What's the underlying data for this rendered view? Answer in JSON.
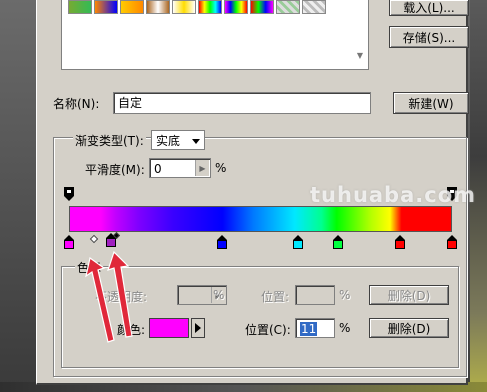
{
  "buttons": {
    "load": "载入(L)...",
    "save": "存储(S)...",
    "new": "新建(W)",
    "delete_opacity": "删除(D)",
    "delete_color": "删除(D)"
  },
  "name": {
    "label": "名称(N):",
    "value": "自定"
  },
  "gradient_type": {
    "label": "渐变类型(T):",
    "value": "实底"
  },
  "smoothness": {
    "label": "平滑度(M):",
    "value": "0",
    "unit": "%"
  },
  "stops_group": {
    "title": "色标",
    "opacity_label": "不透明度:",
    "opacity_unit": "%",
    "opacity_location_label": "位置:",
    "opacity_location_unit": "%",
    "color_label": "颜色:",
    "location_label": "位置(C):",
    "location_value": "11",
    "location_unit": "%"
  },
  "colors": {
    "selected_stop": "#ff00ff",
    "accent_arrows": "#e0283a"
  },
  "color_stops": [
    {
      "position": 0.0,
      "color": "#ff00ff"
    },
    {
      "position": 0.11,
      "color": "#a020c0"
    },
    {
      "position": 0.4,
      "color": "#0000ff"
    },
    {
      "position": 0.6,
      "color": "#00e8ff"
    },
    {
      "position": 0.7,
      "color": "#00ff00"
    },
    {
      "position": 0.87,
      "color": "#ff0000"
    },
    {
      "position": 1.0,
      "color": "#ff0000"
    }
  ],
  "watermark": "tuhuaba.com"
}
